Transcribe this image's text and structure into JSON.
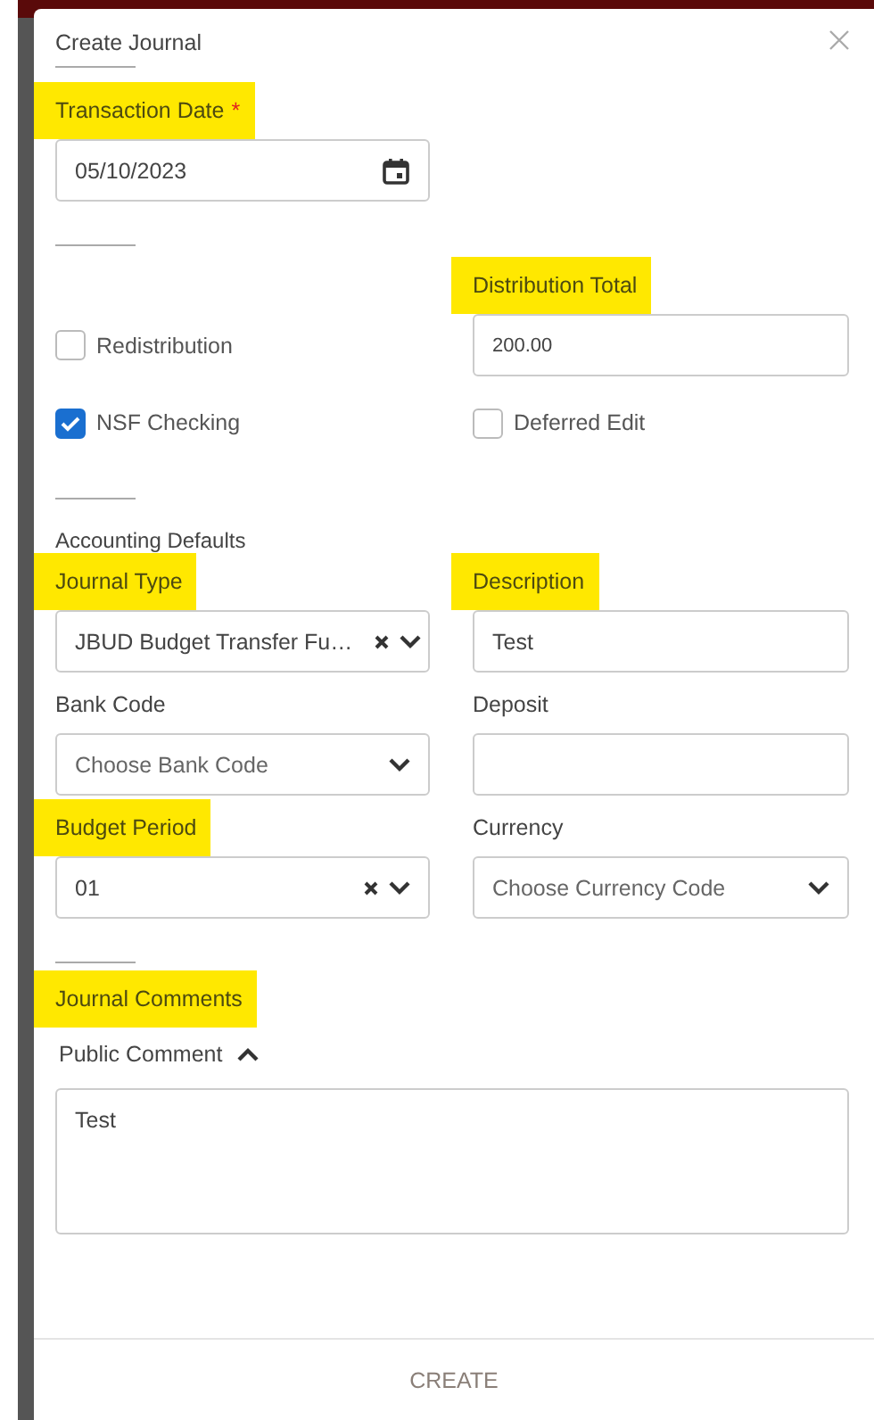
{
  "dialog": {
    "title": "Create Journal"
  },
  "transaction_date": {
    "label": "Transaction Date",
    "required_mark": "*",
    "highlighted": true,
    "value": "05/10/2023"
  },
  "distribution_total": {
    "label": "Distribution Total",
    "highlighted": true,
    "value": "200.00"
  },
  "checkboxes": [
    {
      "label": "Redistribution",
      "checked": false
    },
    {
      "label": "NSF Checking",
      "checked": true
    },
    {
      "label": "Deferred Edit",
      "checked": false
    }
  ],
  "accounting_defaults": {
    "heading": "Accounting Defaults",
    "fields": [
      {
        "kind": "select",
        "label": "Journal Type",
        "highlighted": true,
        "value": "JBUD Budget Transfer Fu…",
        "clearable": true
      },
      {
        "kind": "text",
        "label": "Description",
        "highlighted": true,
        "value": "Test"
      },
      {
        "kind": "select",
        "label": "Bank Code",
        "highlighted": false,
        "placeholder": "Choose Bank Code",
        "clearable": false
      },
      {
        "kind": "text",
        "label": "Deposit",
        "highlighted": false
      },
      {
        "kind": "select",
        "label": "Budget Period",
        "highlighted": true,
        "value": "01",
        "clearable": true
      },
      {
        "kind": "select",
        "label": "Currency",
        "highlighted": false,
        "placeholder": "Choose Currency Code",
        "clearable": false
      }
    ]
  },
  "journal_comments": {
    "heading": "Journal Comments",
    "highlighted": true,
    "public_comment": {
      "label": "Public Comment",
      "expanded": true,
      "value": "Test"
    }
  },
  "footer": {
    "create_button": "CREATE"
  }
}
